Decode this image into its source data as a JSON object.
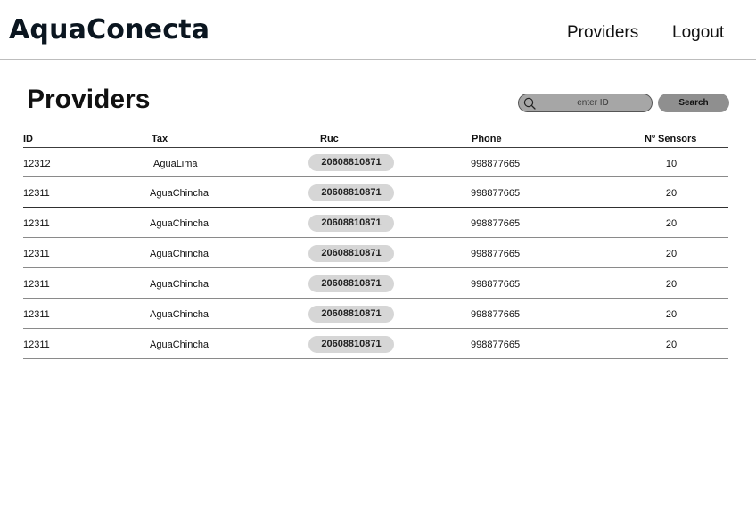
{
  "header": {
    "brand": "AquaConecta",
    "nav": {
      "providers": "Providers",
      "logout": "Logout"
    }
  },
  "page": {
    "title": "Providers"
  },
  "search": {
    "placeholder": "enter ID",
    "value": "",
    "button_label": "Search",
    "icon": "search-icon"
  },
  "table": {
    "columns": {
      "id": "ID",
      "tax": "Tax",
      "ruc": "Ruc",
      "phone": "Phone",
      "sensors": "Nº Sensors"
    },
    "rows": [
      {
        "id": "12312",
        "tax": "AguaLima",
        "ruc": "20608810871",
        "phone": "998877665",
        "sensors": "10"
      },
      {
        "id": "12311",
        "tax": "AguaChincha",
        "ruc": "20608810871",
        "phone": "998877665",
        "sensors": "20"
      },
      {
        "id": "12311",
        "tax": "AguaChincha",
        "ruc": "20608810871",
        "phone": "998877665",
        "sensors": "20"
      },
      {
        "id": "12311",
        "tax": "AguaChincha",
        "ruc": "20608810871",
        "phone": "998877665",
        "sensors": "20"
      },
      {
        "id": "12311",
        "tax": "AguaChincha",
        "ruc": "20608810871",
        "phone": "998877665",
        "sensors": "20"
      },
      {
        "id": "12311",
        "tax": "AguaChincha",
        "ruc": "20608810871",
        "phone": "998877665",
        "sensors": "20"
      },
      {
        "id": "12311",
        "tax": "AguaChincha",
        "ruc": "20608810871",
        "phone": "998877665",
        "sensors": "20"
      }
    ]
  },
  "colors": {
    "brand": "#0b1620",
    "search_field": "#a6a6a6",
    "search_button": "#8f8f8f",
    "ruc_pill": "#d6d6d6"
  }
}
